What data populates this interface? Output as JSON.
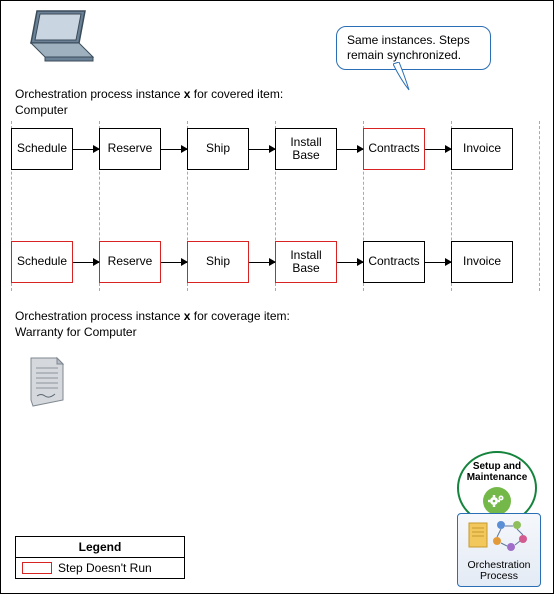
{
  "callout": "Same instances. Steps remain synchronized.",
  "label_top_a": "Orchestration process instance",
  "label_top_x": "x",
  "label_top_b": "for covered item:",
  "label_top_c": "Computer",
  "label_mid_a": "Orchestration process instance",
  "label_mid_x": "x",
  "label_mid_b": "for coverage item:",
  "label_mid_c": "Warranty for Computer",
  "steps": {
    "schedule": "Schedule",
    "reserve": "Reserve",
    "ship": "Ship",
    "install_base": "Install Base",
    "contracts": "Contracts",
    "invoice": "Invoice"
  },
  "flow_top_notrun": [
    false,
    false,
    false,
    false,
    true,
    false
  ],
  "flow_bot_notrun": [
    true,
    true,
    true,
    true,
    false,
    false
  ],
  "badge": {
    "title_a": "Setup and",
    "title_b": "Maintenance"
  },
  "tile": {
    "line1": "Orchestration",
    "line2": "Process"
  },
  "legend": {
    "title": "Legend",
    "not_run": "Step Doesn't Run"
  }
}
